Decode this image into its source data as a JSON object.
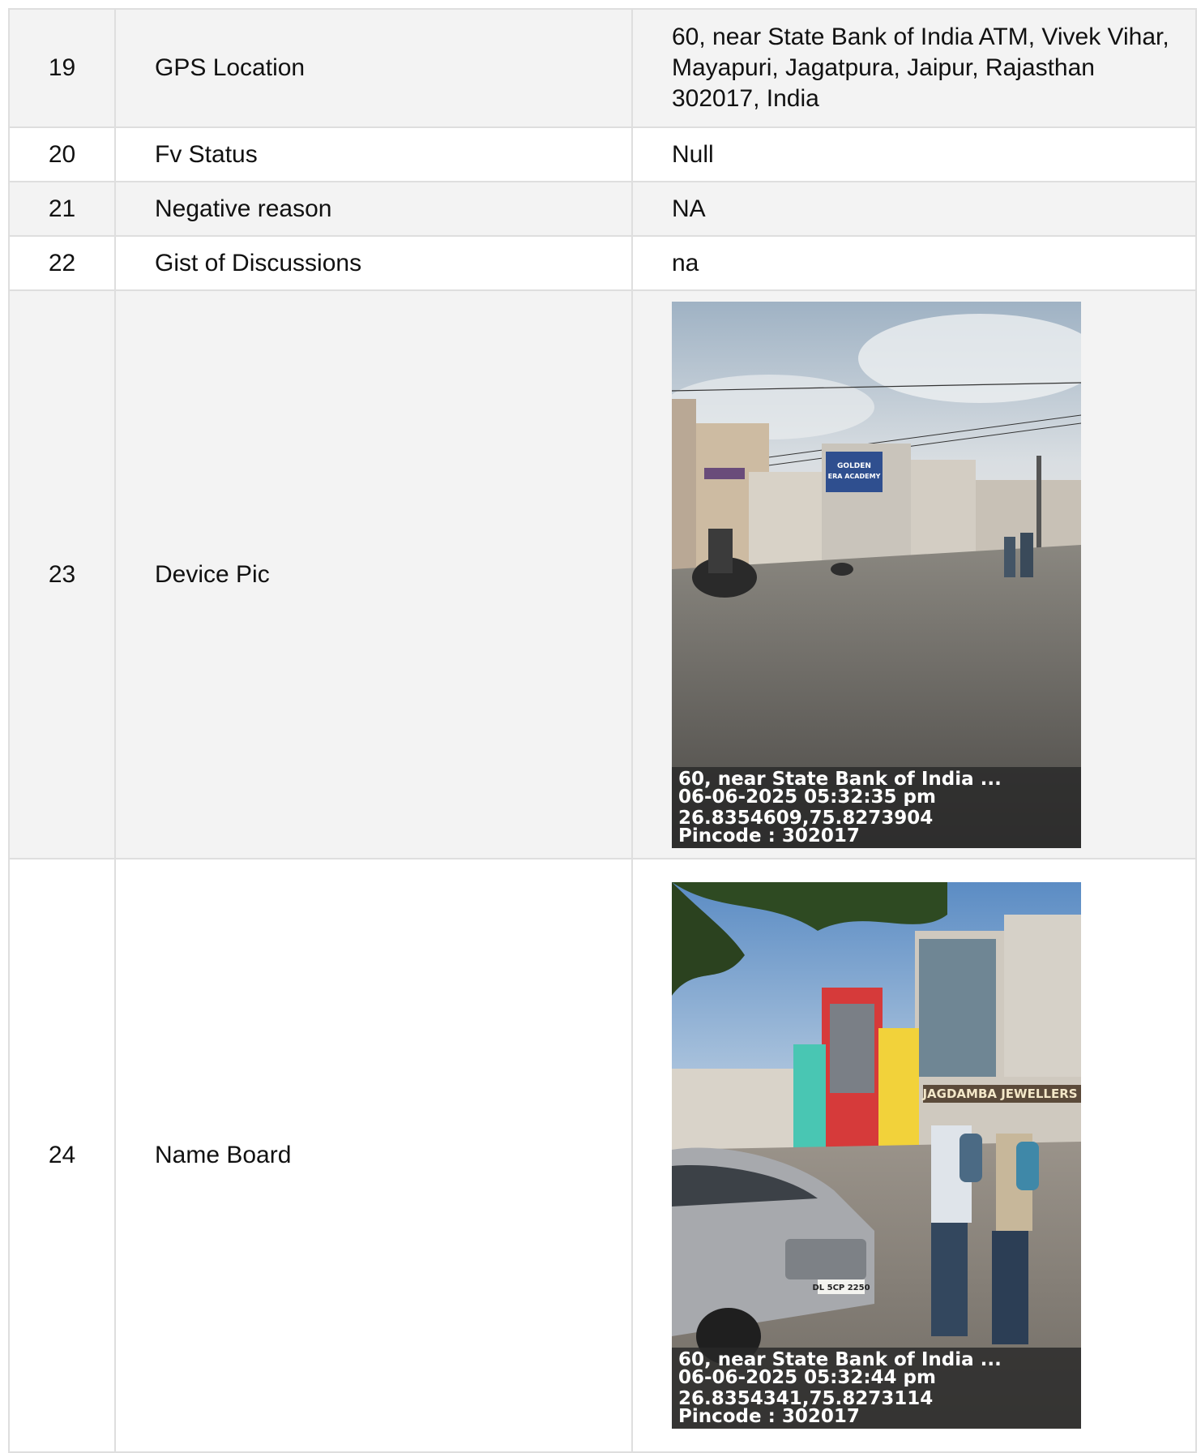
{
  "rows": [
    {
      "num": "19",
      "label": "GPS Location",
      "value": "60, near State Bank of India ATM, Vivek Vihar, Mayapuri, Jagatpura, Jaipur, Rajasthan 302017, India"
    },
    {
      "num": "20",
      "label": "Fv Status",
      "value": "Null"
    },
    {
      "num": "21",
      "label": "Negative reason",
      "value": "NA"
    },
    {
      "num": "22",
      "label": "Gist of Discussions",
      "value": "na"
    },
    {
      "num": "23",
      "label": "Device Pic",
      "photo": {
        "address": "60, near State Bank of India ...",
        "datetime": "06-06-2025 05:32:35 pm",
        "coords": "26.8354609,75.8273904",
        "pincode": "Pincode : 302017",
        "sign_text": [
          "GOLDEN",
          "ERA ACADEMY"
        ]
      }
    },
    {
      "num": "24",
      "label": "Name Board",
      "photo": {
        "address": "60, near State Bank of India ...",
        "datetime": "06-06-2025 05:32:44 pm",
        "coords": "26.8354341,75.8273114",
        "pincode": "Pincode : 302017",
        "sign_text": [
          "JAGDAMBA JEWELLERS",
          "DL 5CP 2250"
        ]
      }
    }
  ],
  "colors": {
    "row_alt": "#f3f3f3",
    "border": "#dedede",
    "caption_bg": "#282828"
  }
}
